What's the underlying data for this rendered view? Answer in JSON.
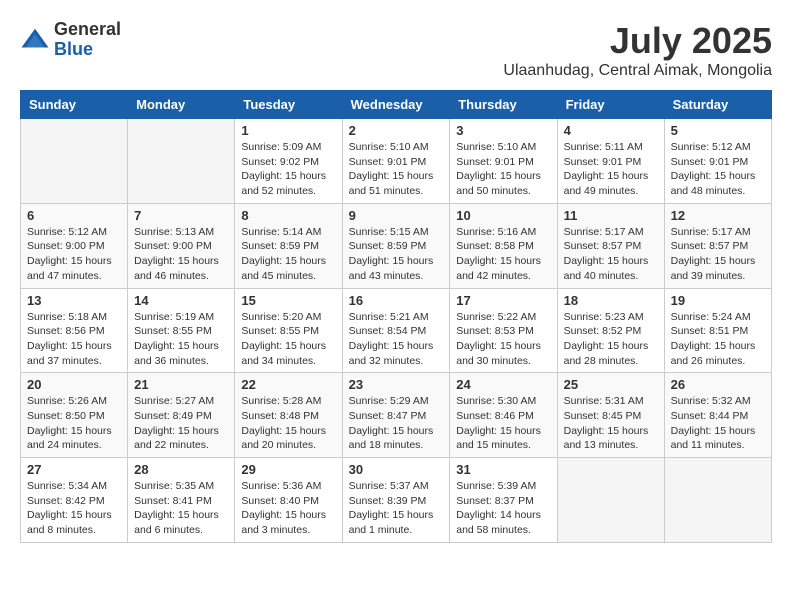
{
  "header": {
    "logo_general": "General",
    "logo_blue": "Blue",
    "month_year": "July 2025",
    "location": "Ulaanhudag, Central Aimak, Mongolia"
  },
  "weekdays": [
    "Sunday",
    "Monday",
    "Tuesday",
    "Wednesday",
    "Thursday",
    "Friday",
    "Saturday"
  ],
  "weeks": [
    [
      {
        "day": "",
        "info": ""
      },
      {
        "day": "",
        "info": ""
      },
      {
        "day": "1",
        "info": "Sunrise: 5:09 AM\nSunset: 9:02 PM\nDaylight: 15 hours and 52 minutes."
      },
      {
        "day": "2",
        "info": "Sunrise: 5:10 AM\nSunset: 9:01 PM\nDaylight: 15 hours and 51 minutes."
      },
      {
        "day": "3",
        "info": "Sunrise: 5:10 AM\nSunset: 9:01 PM\nDaylight: 15 hours and 50 minutes."
      },
      {
        "day": "4",
        "info": "Sunrise: 5:11 AM\nSunset: 9:01 PM\nDaylight: 15 hours and 49 minutes."
      },
      {
        "day": "5",
        "info": "Sunrise: 5:12 AM\nSunset: 9:01 PM\nDaylight: 15 hours and 48 minutes."
      }
    ],
    [
      {
        "day": "6",
        "info": "Sunrise: 5:12 AM\nSunset: 9:00 PM\nDaylight: 15 hours and 47 minutes."
      },
      {
        "day": "7",
        "info": "Sunrise: 5:13 AM\nSunset: 9:00 PM\nDaylight: 15 hours and 46 minutes."
      },
      {
        "day": "8",
        "info": "Sunrise: 5:14 AM\nSunset: 8:59 PM\nDaylight: 15 hours and 45 minutes."
      },
      {
        "day": "9",
        "info": "Sunrise: 5:15 AM\nSunset: 8:59 PM\nDaylight: 15 hours and 43 minutes."
      },
      {
        "day": "10",
        "info": "Sunrise: 5:16 AM\nSunset: 8:58 PM\nDaylight: 15 hours and 42 minutes."
      },
      {
        "day": "11",
        "info": "Sunrise: 5:17 AM\nSunset: 8:57 PM\nDaylight: 15 hours and 40 minutes."
      },
      {
        "day": "12",
        "info": "Sunrise: 5:17 AM\nSunset: 8:57 PM\nDaylight: 15 hours and 39 minutes."
      }
    ],
    [
      {
        "day": "13",
        "info": "Sunrise: 5:18 AM\nSunset: 8:56 PM\nDaylight: 15 hours and 37 minutes."
      },
      {
        "day": "14",
        "info": "Sunrise: 5:19 AM\nSunset: 8:55 PM\nDaylight: 15 hours and 36 minutes."
      },
      {
        "day": "15",
        "info": "Sunrise: 5:20 AM\nSunset: 8:55 PM\nDaylight: 15 hours and 34 minutes."
      },
      {
        "day": "16",
        "info": "Sunrise: 5:21 AM\nSunset: 8:54 PM\nDaylight: 15 hours and 32 minutes."
      },
      {
        "day": "17",
        "info": "Sunrise: 5:22 AM\nSunset: 8:53 PM\nDaylight: 15 hours and 30 minutes."
      },
      {
        "day": "18",
        "info": "Sunrise: 5:23 AM\nSunset: 8:52 PM\nDaylight: 15 hours and 28 minutes."
      },
      {
        "day": "19",
        "info": "Sunrise: 5:24 AM\nSunset: 8:51 PM\nDaylight: 15 hours and 26 minutes."
      }
    ],
    [
      {
        "day": "20",
        "info": "Sunrise: 5:26 AM\nSunset: 8:50 PM\nDaylight: 15 hours and 24 minutes."
      },
      {
        "day": "21",
        "info": "Sunrise: 5:27 AM\nSunset: 8:49 PM\nDaylight: 15 hours and 22 minutes."
      },
      {
        "day": "22",
        "info": "Sunrise: 5:28 AM\nSunset: 8:48 PM\nDaylight: 15 hours and 20 minutes."
      },
      {
        "day": "23",
        "info": "Sunrise: 5:29 AM\nSunset: 8:47 PM\nDaylight: 15 hours and 18 minutes."
      },
      {
        "day": "24",
        "info": "Sunrise: 5:30 AM\nSunset: 8:46 PM\nDaylight: 15 hours and 15 minutes."
      },
      {
        "day": "25",
        "info": "Sunrise: 5:31 AM\nSunset: 8:45 PM\nDaylight: 15 hours and 13 minutes."
      },
      {
        "day": "26",
        "info": "Sunrise: 5:32 AM\nSunset: 8:44 PM\nDaylight: 15 hours and 11 minutes."
      }
    ],
    [
      {
        "day": "27",
        "info": "Sunrise: 5:34 AM\nSunset: 8:42 PM\nDaylight: 15 hours and 8 minutes."
      },
      {
        "day": "28",
        "info": "Sunrise: 5:35 AM\nSunset: 8:41 PM\nDaylight: 15 hours and 6 minutes."
      },
      {
        "day": "29",
        "info": "Sunrise: 5:36 AM\nSunset: 8:40 PM\nDaylight: 15 hours and 3 minutes."
      },
      {
        "day": "30",
        "info": "Sunrise: 5:37 AM\nSunset: 8:39 PM\nDaylight: 15 hours and 1 minute."
      },
      {
        "day": "31",
        "info": "Sunrise: 5:39 AM\nSunset: 8:37 PM\nDaylight: 14 hours and 58 minutes."
      },
      {
        "day": "",
        "info": ""
      },
      {
        "day": "",
        "info": ""
      }
    ]
  ]
}
